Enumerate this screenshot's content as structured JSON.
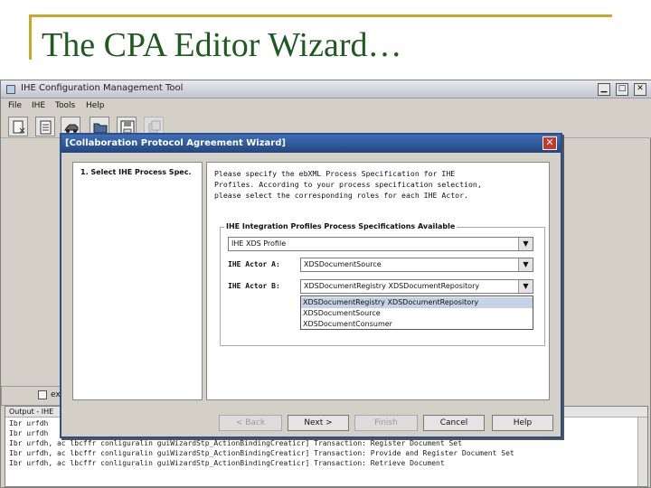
{
  "slide": {
    "title": "The CPA Editor Wizard…"
  },
  "app": {
    "title": "IHE Configuration Management Tool",
    "window_controls": {
      "minimize": "▁",
      "maximize": "□",
      "close": "✕"
    },
    "menu": [
      "File",
      "IHE",
      "Tools",
      "Help"
    ],
    "toolbar_icons": [
      "new-document-icon",
      "notepad-icon",
      "car-icon",
      "open-folder-icon",
      "save-icon",
      "copy-icon"
    ],
    "side_tab_label": "ex",
    "output": {
      "header": "Output - IHE",
      "lines": [
        "Ibr urfdh",
        "Ibr urfdh",
        "Ibr urfdh, ac lbcffr conliguralin guiWizardStp_ActionBindingCreaticr] Transaction: Register Document Set",
        "Ibr urfdh, ac lbcffr conliguralin guiWizardStp_ActionBindingCreaticr] Transaction: Provide and Register Document Set",
        "Ibr urfdh, ac lbcffr conliguralin guiWizardStp_ActionBindingCreaticr] Transaction: Retrieve Document"
      ]
    }
  },
  "dialog": {
    "title": "[Collaboration Protocol Agreement Wizard]",
    "close": "✕",
    "step": "1. Select IHE Process Spec.",
    "instructions": [
      "Please specify the ebXML Process Specification for IHE",
      "Profiles. According to your process specification selection,",
      "please select the corresponding roles for each IHE Actor."
    ],
    "group_title": "IHE Integration Profiles Process Specifications Available",
    "profile_value": "IHE XDS Profile",
    "actor_a_label": "IHE Actor A:",
    "actor_a_value": "XDSDocumentSource",
    "actor_b_label": "IHE Actor B:",
    "actor_b_value": "XDSDocumentRegistry XDSDocumentRepository",
    "actor_b_options": [
      "XDSDocumentRegistry XDSDocumentRepository",
      "XDSDocumentSource",
      "XDSDocumentConsumer"
    ],
    "buttons": {
      "back": "< Back",
      "next": "Next >",
      "finish": "Finish",
      "cancel": "Cancel",
      "help": "Help"
    }
  }
}
